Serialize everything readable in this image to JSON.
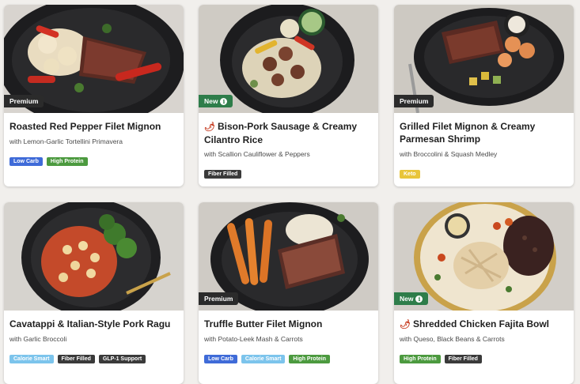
{
  "cards": [
    {
      "badge": "Premium",
      "title": "Roasted Red Pepper Filet Mignon",
      "subtitle": "with Lemon-Garlic Tortellini Primavera",
      "tags": [
        {
          "label": "Low Carb",
          "color": "#3f6bd8"
        },
        {
          "label": "High Protein",
          "color": "#4c9a3f"
        }
      ]
    },
    {
      "badge": "New",
      "title": "Bison-Pork Sausage & Creamy Cilantro Rice",
      "subtitle": "with Scallion Cauliflower & Peppers",
      "spicy": true,
      "tags": [
        {
          "label": "Fiber Filled",
          "color": "#3a3a3a"
        }
      ]
    },
    {
      "badge": "Premium",
      "title": "Grilled Filet Mignon & Creamy Parmesan Shrimp",
      "subtitle": "with Broccolini & Squash Medley",
      "tags": [
        {
          "label": "Keto",
          "color": "#e8c53a"
        }
      ]
    },
    {
      "badge": "",
      "title": "Cavatappi & Italian-Style Pork Ragu",
      "subtitle": "with Garlic Broccoli",
      "tags": [
        {
          "label": "Calorie Smart",
          "color": "#7cc4ec"
        },
        {
          "label": "Fiber Filled",
          "color": "#3a3a3a"
        },
        {
          "label": "GLP-1 Support",
          "color": "#3a3a3a"
        }
      ]
    },
    {
      "badge": "Premium",
      "title": "Truffle Butter Filet Mignon",
      "subtitle": "with Potato-Leek Mash & Carrots",
      "tags": [
        {
          "label": "Low Carb",
          "color": "#3f6bd8"
        },
        {
          "label": "Calorie Smart",
          "color": "#7cc4ec"
        },
        {
          "label": "High Protein",
          "color": "#4c9a3f"
        }
      ]
    },
    {
      "badge": "New",
      "title": "Shredded Chicken Fajita Bowl",
      "subtitle": "with Queso, Black Beans & Carrots",
      "spicy": true,
      "tags": [
        {
          "label": "High Protein",
          "color": "#4c9a3f"
        },
        {
          "label": "Fiber Filled",
          "color": "#3a3a3a"
        }
      ]
    }
  ],
  "info_glyph": "i",
  "pepper_glyph": "🌶"
}
